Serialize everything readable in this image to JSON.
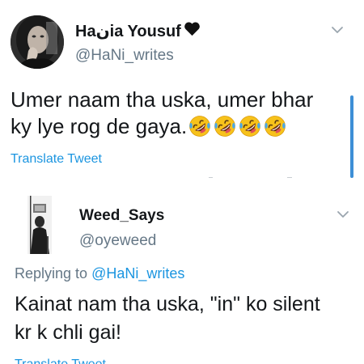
{
  "tweet": {
    "author_name": "Haنia Yousuf",
    "author_handle": "@HaNi_writes",
    "name_suffix_icon": "black-heart-icon",
    "text_line1": "Umer naam tha uska, umer bhar",
    "text_line2": "ky lye rog de gaya.",
    "emoji_icon": "rolling-on-floor-laughing-emoji",
    "emoji_count": 4,
    "translate_label": "Translate Tweet",
    "menu_icon": "chevron-down-icon"
  },
  "reply": {
    "author_name": "Weed_Says",
    "author_handle": "@oyeweed",
    "replying_prefix": "Replying to",
    "replying_handle": "@HaNi_writes",
    "text_line1": "Kainat nam tha uska, \"in\" ko silent",
    "text_line2": "kr k chli gai!",
    "translate_label": "Translate Tweet",
    "menu_icon": "chevron-down-icon"
  },
  "colors": {
    "text_primary": "#14171a",
    "text_secondary": "#657786",
    "link_blue": "#1b95e0",
    "scrollbar": "#3d8fd6",
    "background": "#ffffff"
  }
}
